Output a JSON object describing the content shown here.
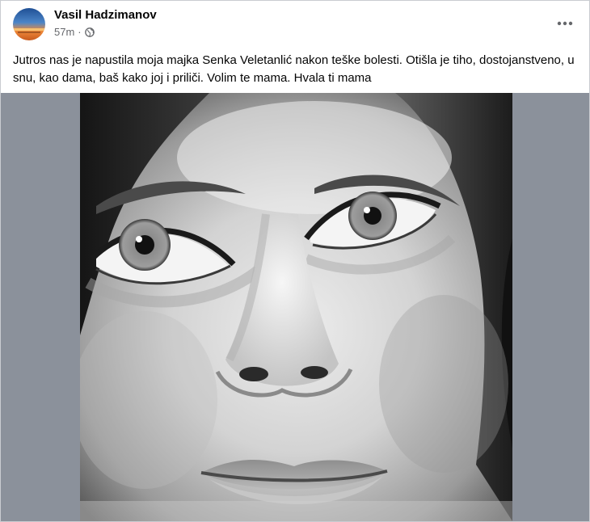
{
  "post": {
    "author_name": "Vasil Hadzimanov",
    "time": "57m",
    "separator": "·",
    "audience_icon": "globe-icon",
    "more_icon": "more-horizontal-icon",
    "text": "Jutros nas je napustila moja majka Senka Veletanlić nakon teške bolesti. Otišla je tiho, dostojanstveno, u snu, kao dama, baš kako joj i priliči. Volim te mama. Hvala ti mama",
    "photo": {
      "description": "black-and-white close-up portrait of a woman's face",
      "letterbox_color": "#8b919b"
    }
  },
  "colors": {
    "text_primary": "#050505",
    "text_secondary": "#65676b",
    "border": "#c9ccd1",
    "avatar_sky": "#3b6fb0",
    "avatar_sunset": "#e8762c"
  }
}
